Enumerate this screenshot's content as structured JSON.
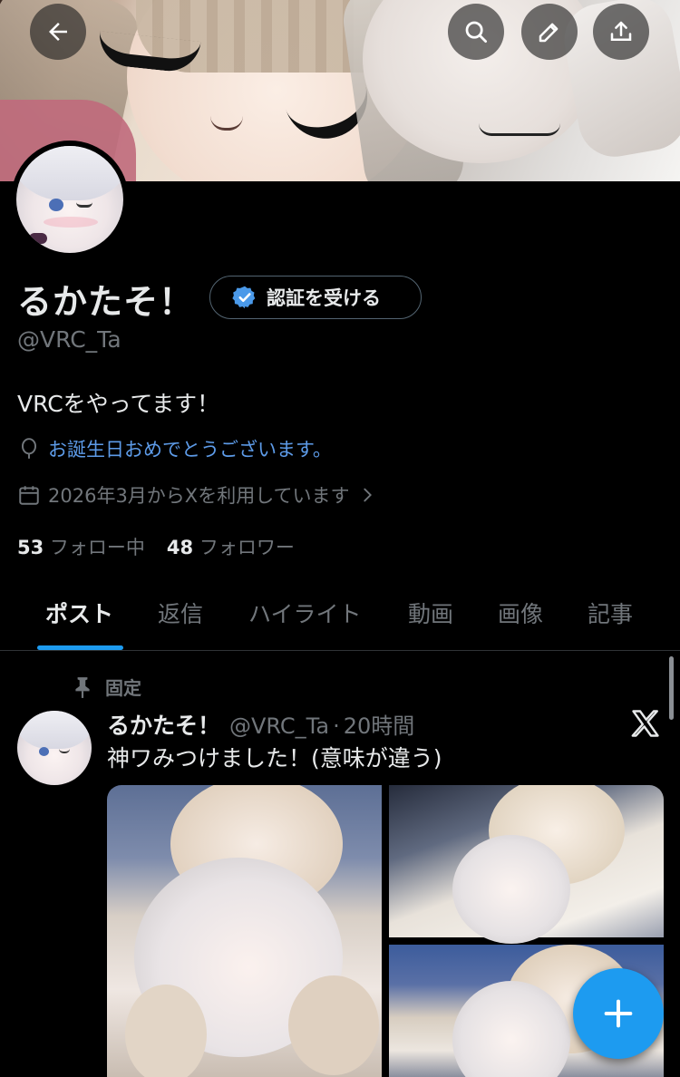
{
  "header": {
    "back_icon": "arrow-left-icon",
    "search_icon": "search-icon",
    "edit_icon": "pencil-icon",
    "share_icon": "share-icon"
  },
  "profile": {
    "display_name": "るかたそ！",
    "verify_button_label": "認証を受ける",
    "handle": "@VRC_Ta",
    "bio": "VRCをやってます！",
    "birthday_text": "お誕生日おめでとうございます。",
    "joined_text": "2026年3月からXを利用しています",
    "following_count": "53",
    "following_label": "フォロー中",
    "followers_count": "48",
    "followers_label": "フォロワー"
  },
  "tabs": [
    {
      "label": "ポスト",
      "active": true
    },
    {
      "label": "返信",
      "active": false
    },
    {
      "label": "ハイライト",
      "active": false
    },
    {
      "label": "動画",
      "active": false
    },
    {
      "label": "画像",
      "active": false
    },
    {
      "label": "記事",
      "active": false
    }
  ],
  "pinned_post": {
    "pinned_label": "固定",
    "author_name": "るかたそ！",
    "author_handle": "@VRC_Ta",
    "separator": "·",
    "time": "20時間",
    "text": "神ワみつけました！(意味が違う)",
    "media_count": 3
  },
  "colors": {
    "accent": "#1d9bf0",
    "link": "#5d9be8",
    "muted": "#71767b",
    "background": "#000000"
  },
  "fab": {
    "icon": "plus-icon"
  }
}
